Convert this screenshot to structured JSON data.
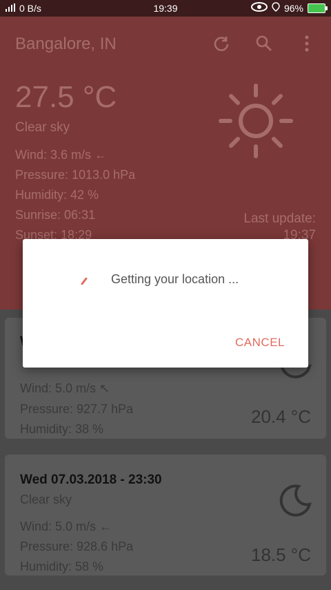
{
  "status_bar": {
    "network": "0 B/s",
    "time": "19:39",
    "battery": "96%"
  },
  "header": {
    "city": "Bangalore, IN",
    "temperature": "27.5 °C",
    "description": "Clear sky",
    "wind": "Wind: 3.6 m/s ←",
    "pressure": "Pressure: 1013.0 hPa",
    "humidity": "Humidity: 42 %",
    "sunrise": "Sunrise: 06:31",
    "sunset": "Sunset: 18:29",
    "last_update_label": "Last update:",
    "last_update_time": "19:37"
  },
  "toolbar": {
    "refresh_icon": "refresh-icon",
    "search_icon": "search-icon",
    "menu_icon": "more-vert-icon"
  },
  "forecast": [
    {
      "wind": "Wind: 5.0 m/s ↖",
      "pressure": "Pressure: 927.7 hPa",
      "humidity": "Humidity: 38 %",
      "temperature": "20.4 °C"
    },
    {
      "date": "Wed 07.03.2018 - 23:30",
      "description": "Clear sky",
      "wind": "Wind: 5.0 m/s ←",
      "pressure": "Pressure: 928.6 hPa",
      "humidity": "Humidity: 58 %",
      "temperature": "18.5 °C"
    }
  ],
  "dialog": {
    "message": "Getting your location ...",
    "cancel_label": "CANCEL"
  },
  "colors": {
    "accent": "#e06b5f",
    "header_dim": "#7b3838"
  }
}
